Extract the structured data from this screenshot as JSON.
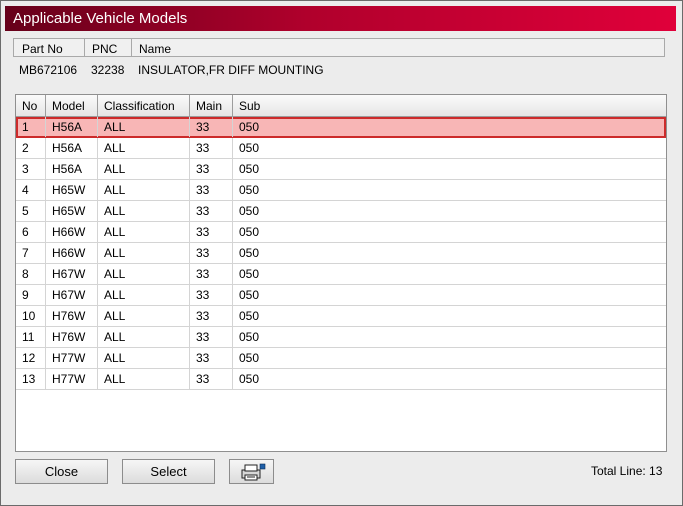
{
  "window": {
    "title": "Applicable Vehicle Models"
  },
  "part_info": {
    "headers": {
      "part_no": "Part No",
      "pnc": "PNC",
      "name": "Name"
    },
    "values": {
      "part_no": "MB672106",
      "pnc": "32238",
      "name": "INSULATOR,FR DIFF MOUNTING"
    }
  },
  "table": {
    "columns": [
      "No",
      "Model",
      "Classification",
      "Main",
      "Sub"
    ],
    "selected_row": 1,
    "rows": [
      [
        "1",
        "H56A",
        "ALL",
        "33",
        "050"
      ],
      [
        "2",
        "H56A",
        "ALL",
        "33",
        "050"
      ],
      [
        "3",
        "H56A",
        "ALL",
        "33",
        "050"
      ],
      [
        "4",
        "H65W",
        "ALL",
        "33",
        "050"
      ],
      [
        "5",
        "H65W",
        "ALL",
        "33",
        "050"
      ],
      [
        "6",
        "H66W",
        "ALL",
        "33",
        "050"
      ],
      [
        "7",
        "H66W",
        "ALL",
        "33",
        "050"
      ],
      [
        "8",
        "H67W",
        "ALL",
        "33",
        "050"
      ],
      [
        "9",
        "H67W",
        "ALL",
        "33",
        "050"
      ],
      [
        "10",
        "H76W",
        "ALL",
        "33",
        "050"
      ],
      [
        "11",
        "H76W",
        "ALL",
        "33",
        "050"
      ],
      [
        "12",
        "H77W",
        "ALL",
        "33",
        "050"
      ],
      [
        "13",
        "H77W",
        "ALL",
        "33",
        "050"
      ]
    ]
  },
  "buttons": {
    "close": "Close",
    "select": "Select",
    "print_icon": "printer-icon"
  },
  "footer": {
    "total_line": "Total Line: 13"
  },
  "colors": {
    "title_dark": "#66001a",
    "title_bright": "#e0003a",
    "selection_fill": "#f8b6b6",
    "selection_border": "#cc2b2b"
  }
}
